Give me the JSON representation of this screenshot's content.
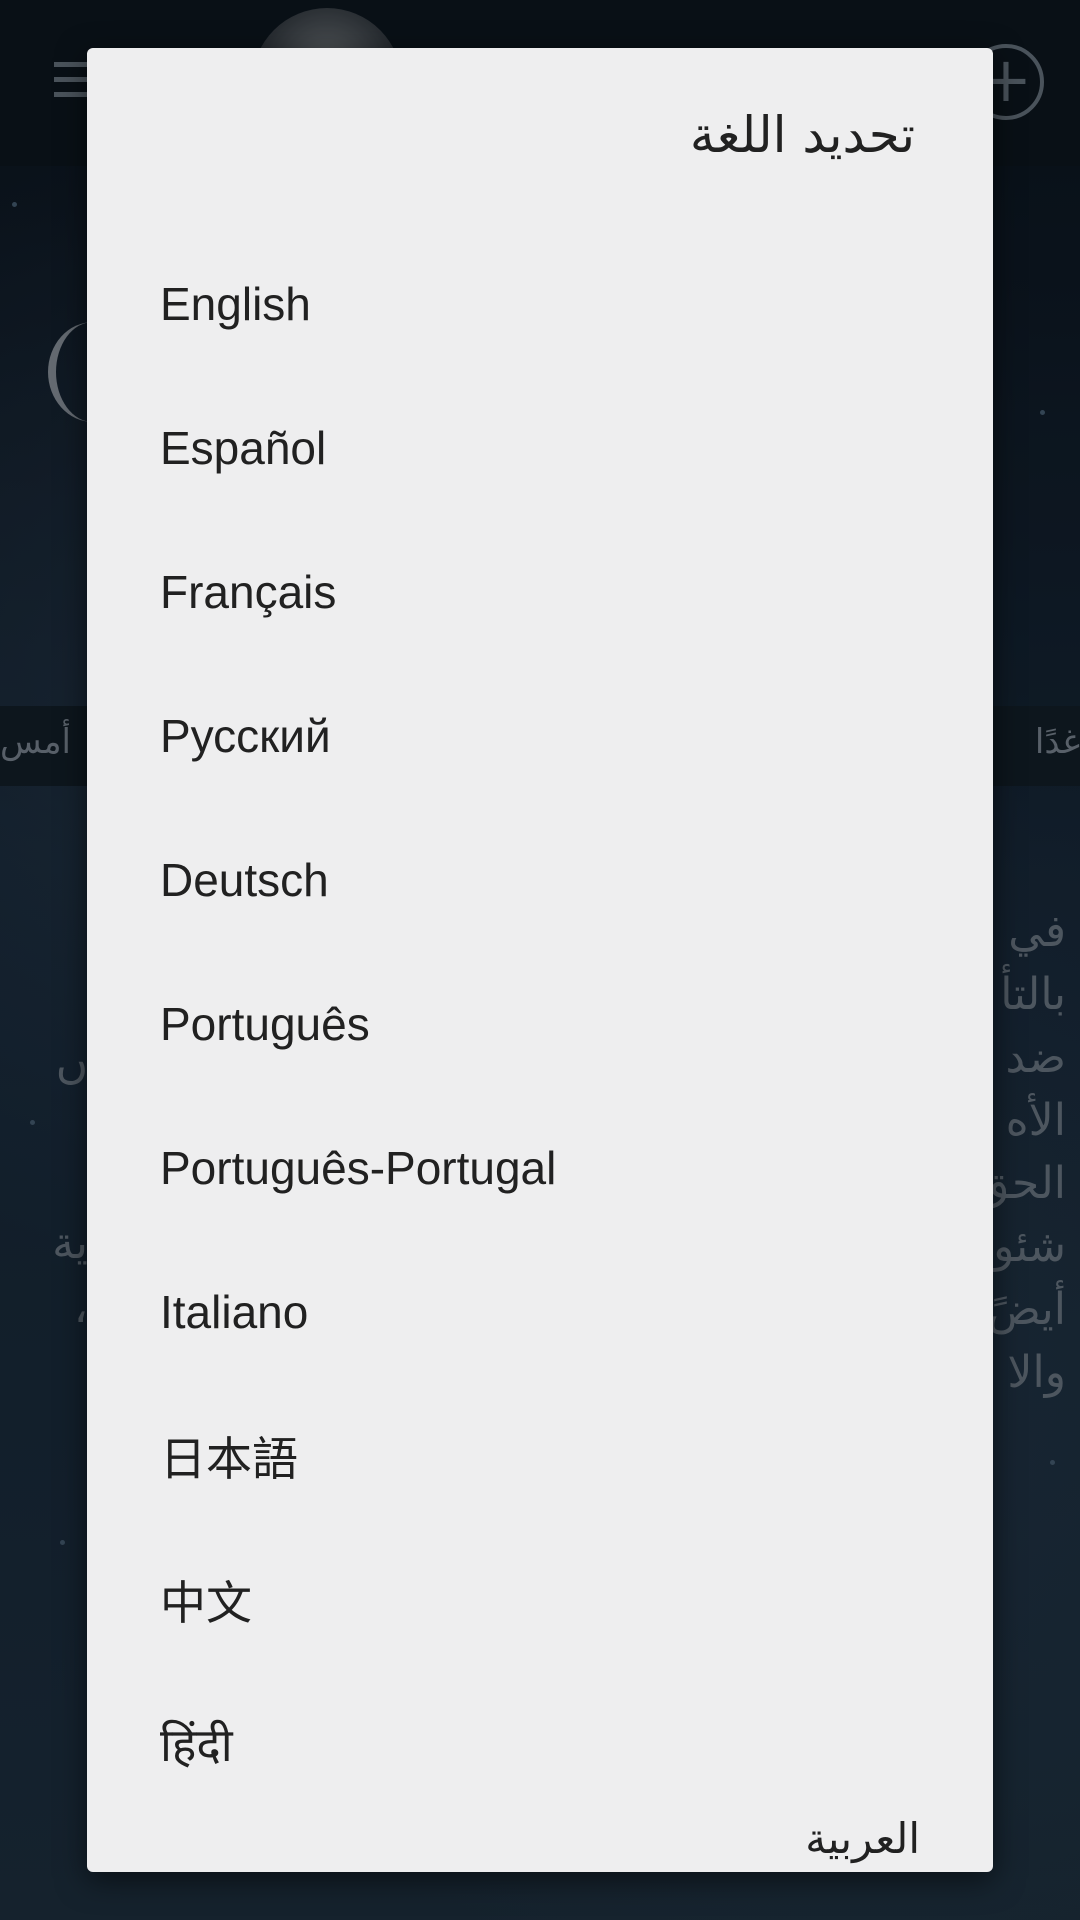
{
  "background": {
    "yesterday_label": "أمس",
    "tomorrow_label": "غدًا",
    "article_right_lines": [
      "في",
      "بالتأ",
      "ضد",
      "الأه",
      "الحق",
      "شئو",
      "أيضً",
      "والا"
    ],
    "article_left_fragments": [
      "ں",
      "ية",
      "،"
    ],
    "icons": [
      "menu-icon",
      "avatar",
      "add-icon",
      "moon-icon"
    ]
  },
  "dialog": {
    "title": "تحديد اللغة",
    "languages": [
      "English",
      "Español",
      "Français",
      "Русский",
      "Deutsch",
      "Português",
      "Português-Portugal",
      "Italiano",
      "日本語",
      "中文",
      "हिंदी"
    ],
    "partial_language": "العربية"
  }
}
